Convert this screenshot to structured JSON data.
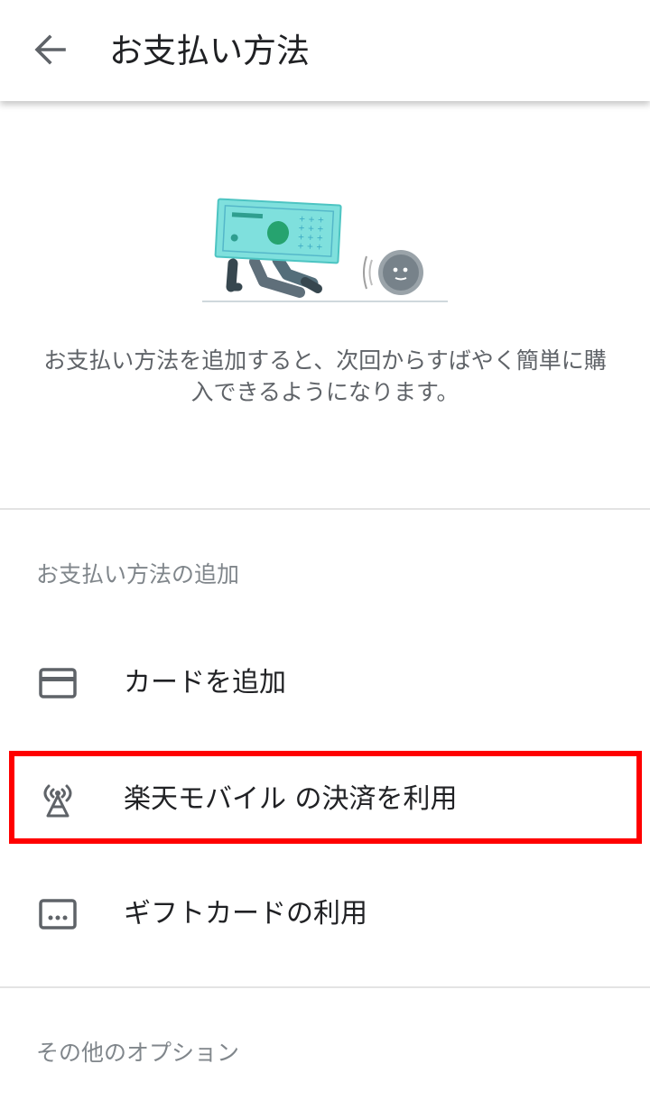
{
  "header": {
    "back_icon": "arrow-back-icon",
    "title": "お支払い方法"
  },
  "hero": {
    "illustration": "running-card-and-coin-illustration",
    "description": "お支払い方法を追加すると、次回からすばやく簡単に購入できるようになります。",
    "description_line1": "お支払い方法を追加すると、次回からすばやく簡単に購",
    "description_line2": "入できるようになります。"
  },
  "add_section": {
    "label": "お支払い方法の追加",
    "items": [
      {
        "icon": "credit-card-icon",
        "label": "カードを追加"
      },
      {
        "icon": "carrier-tower-icon",
        "label": "楽天モバイル の決済を利用",
        "highlighted": true
      },
      {
        "icon": "gift-card-icon",
        "label": "ギフトカードの利用"
      }
    ]
  },
  "other_section": {
    "label": "その他のオプション"
  },
  "colors": {
    "highlight_border": "#ff0000",
    "icon_gray": "#5f6368",
    "text_primary": "#202124",
    "text_secondary": "#80868b",
    "divider": "#e3e3e3"
  }
}
